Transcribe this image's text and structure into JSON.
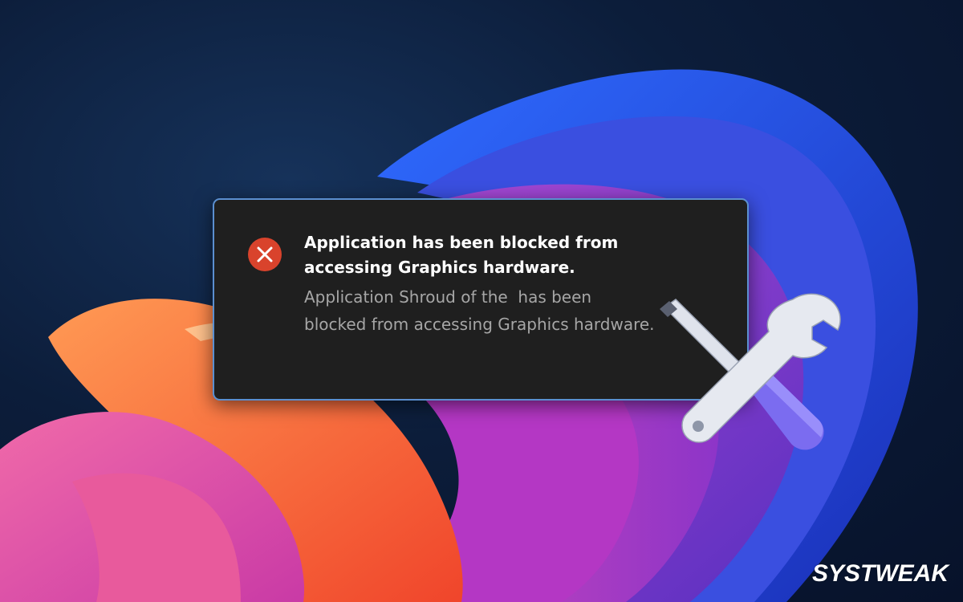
{
  "background": {
    "icon": "windows-11-bloom-wallpaper"
  },
  "notification": {
    "icon": "error-circle-icon",
    "icon_color": "#d9432c",
    "title": "Application has been blocked from accessing Graphics hardware.",
    "body": "Application Shroud of the  has been blocked from accessing Graphics hardware.",
    "border_color": "#5b8fd0"
  },
  "decoration": {
    "icon": "wrench-screwdriver-icon",
    "accent_color": "#7b6cf0"
  },
  "brand": {
    "logo_text": "SYSTWEAK"
  }
}
